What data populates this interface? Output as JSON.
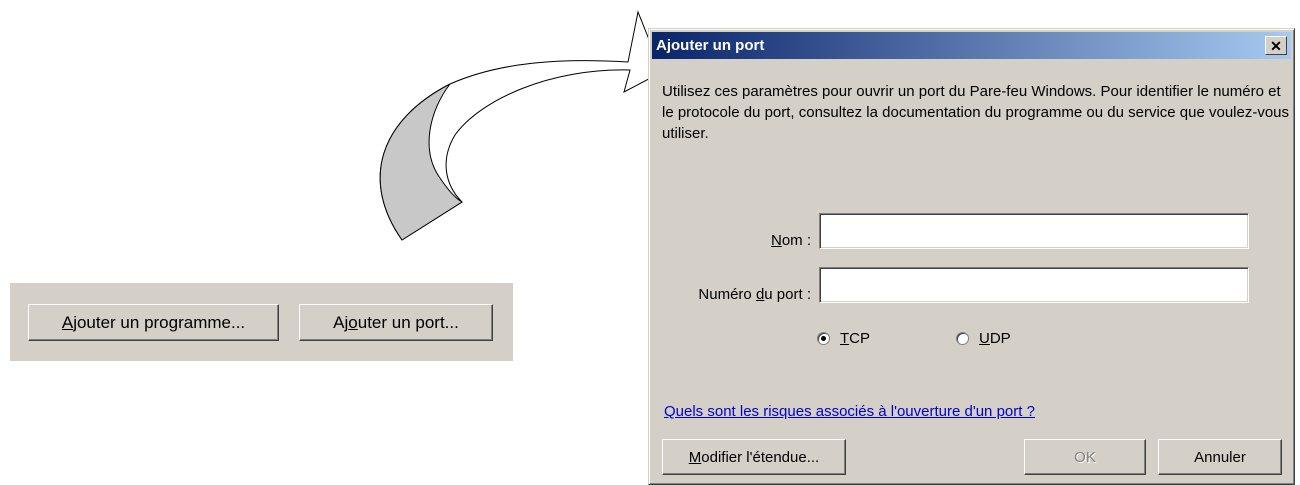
{
  "background_panel": {
    "add_program_label": "Ajouter un programme...",
    "add_program_mnemonic": "A",
    "add_program_rest": "jouter un programme...",
    "add_port_pre": "Aj",
    "add_port_mnemonic": "o",
    "add_port_rest": "uter un port..."
  },
  "dialog": {
    "title": "Ajouter un port",
    "close_glyph": "✕",
    "description": "Utilisez ces paramètres pour ouvrir un port du Pare-feu Windows. Pour identifier le numéro et le protocole du port, consultez la documentation du programme ou du service que voulez-vous utiliser.",
    "name_label_mnemonic": "N",
    "name_label_rest": "om :",
    "name_value": "",
    "port_label_pre": "Numéro ",
    "port_label_mnemonic": "d",
    "port_label_rest": "u port :",
    "port_value": "",
    "protocol_options": [
      {
        "mnemonic": "T",
        "rest": "CP",
        "selected": true
      },
      {
        "mnemonic": "U",
        "rest": "DP",
        "selected": false
      }
    ],
    "risk_link": "Quels sont les risques associés à l'ouverture d'un port ?",
    "modify_scope_mnemonic": "M",
    "modify_scope_rest": "odifier l'étendue...",
    "ok_label": "OK",
    "cancel_label": "Annuler"
  },
  "colors": {
    "dialog_face": "#d4d0c8",
    "title_gradient_start": "#0a246a",
    "title_gradient_end": "#a6caf0",
    "link": "#0000cc",
    "arrow_fill": "#c8c8c8"
  }
}
